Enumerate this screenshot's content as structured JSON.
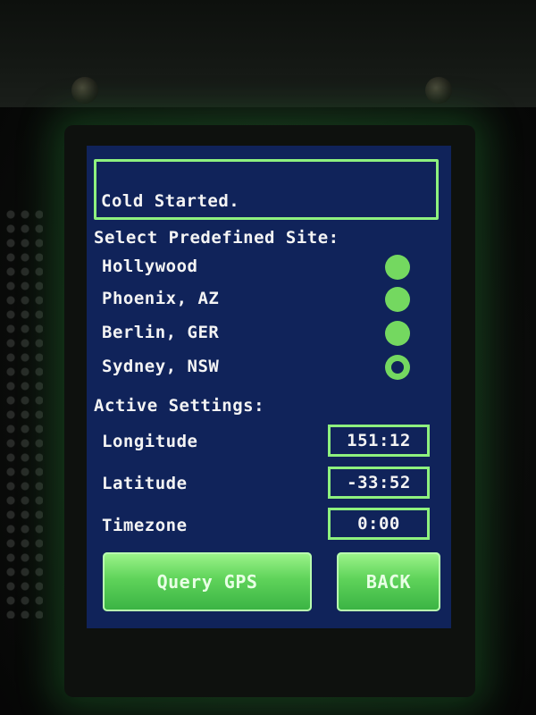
{
  "status": {
    "message": "Cold Started."
  },
  "sites": {
    "heading": "Select Predefined Site:",
    "items": [
      {
        "label": "Hollywood",
        "selected": false
      },
      {
        "label": "Phoenix, AZ",
        "selected": false
      },
      {
        "label": "Berlin, GER",
        "selected": false
      },
      {
        "label": "Sydney, NSW",
        "selected": true
      }
    ]
  },
  "settings": {
    "heading": "Active Settings:",
    "longitude": {
      "label": "Longitude",
      "value": "151:12"
    },
    "latitude": {
      "label": "Latitude",
      "value": "-33:52"
    },
    "timezone": {
      "label": "Timezone",
      "value": "0:00"
    }
  },
  "buttons": {
    "query_gps": "Query GPS",
    "back": "BACK"
  },
  "colors": {
    "screen_background": "#10235a",
    "accent_green": "#8ef17e",
    "radio_green": "#74d860",
    "text": "#f4f4f4"
  }
}
